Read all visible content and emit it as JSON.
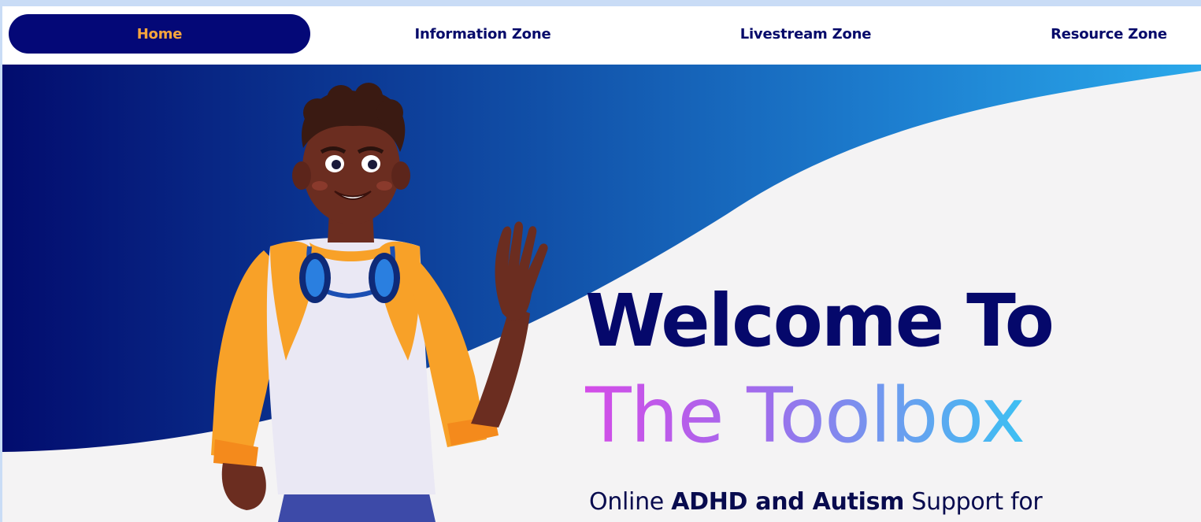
{
  "nav": {
    "items": [
      {
        "label": "Home",
        "active": true
      },
      {
        "label": "Information Zone",
        "active": false
      },
      {
        "label": "Livestream Zone",
        "active": false
      },
      {
        "label": "Resource Zone",
        "active": false
      }
    ]
  },
  "hero": {
    "title_line1": "Welcome To",
    "title_line2": "The Toolbox",
    "tagline": {
      "prefix": "Online ",
      "emphasis": "ADHD and Autism",
      "suffix": " Support for"
    }
  },
  "colors": {
    "nav_active_bg": "#040877",
    "nav_active_text": "#f7a53d",
    "nav_text": "#060a6a",
    "hero_wave_dark": "#020c6e",
    "hero_wave_light": "#2aa8ea",
    "title_color": "#05086b",
    "toolbox_gradient_start": "#d44ce8",
    "toolbox_gradient_end": "#3cc0f3"
  },
  "illustration": {
    "subject": "waving-person-with-headphones-illustration"
  }
}
